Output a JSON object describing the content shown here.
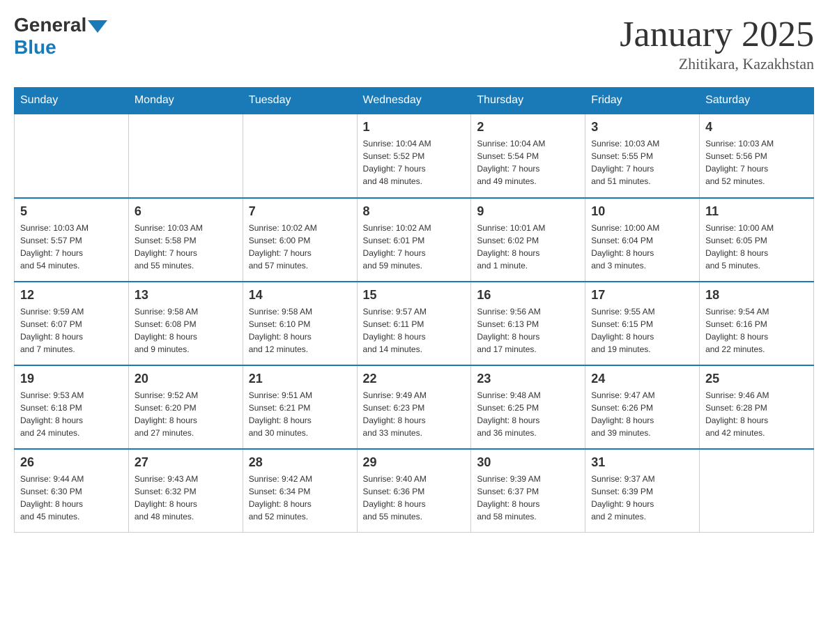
{
  "header": {
    "logo_general": "General",
    "logo_blue": "Blue",
    "month_title": "January 2025",
    "location": "Zhitikara, Kazakhstan"
  },
  "weekdays": [
    "Sunday",
    "Monday",
    "Tuesday",
    "Wednesday",
    "Thursday",
    "Friday",
    "Saturday"
  ],
  "weeks": [
    [
      {
        "day": "",
        "info": ""
      },
      {
        "day": "",
        "info": ""
      },
      {
        "day": "",
        "info": ""
      },
      {
        "day": "1",
        "info": "Sunrise: 10:04 AM\nSunset: 5:52 PM\nDaylight: 7 hours\nand 48 minutes."
      },
      {
        "day": "2",
        "info": "Sunrise: 10:04 AM\nSunset: 5:54 PM\nDaylight: 7 hours\nand 49 minutes."
      },
      {
        "day": "3",
        "info": "Sunrise: 10:03 AM\nSunset: 5:55 PM\nDaylight: 7 hours\nand 51 minutes."
      },
      {
        "day": "4",
        "info": "Sunrise: 10:03 AM\nSunset: 5:56 PM\nDaylight: 7 hours\nand 52 minutes."
      }
    ],
    [
      {
        "day": "5",
        "info": "Sunrise: 10:03 AM\nSunset: 5:57 PM\nDaylight: 7 hours\nand 54 minutes."
      },
      {
        "day": "6",
        "info": "Sunrise: 10:03 AM\nSunset: 5:58 PM\nDaylight: 7 hours\nand 55 minutes."
      },
      {
        "day": "7",
        "info": "Sunrise: 10:02 AM\nSunset: 6:00 PM\nDaylight: 7 hours\nand 57 minutes."
      },
      {
        "day": "8",
        "info": "Sunrise: 10:02 AM\nSunset: 6:01 PM\nDaylight: 7 hours\nand 59 minutes."
      },
      {
        "day": "9",
        "info": "Sunrise: 10:01 AM\nSunset: 6:02 PM\nDaylight: 8 hours\nand 1 minute."
      },
      {
        "day": "10",
        "info": "Sunrise: 10:00 AM\nSunset: 6:04 PM\nDaylight: 8 hours\nand 3 minutes."
      },
      {
        "day": "11",
        "info": "Sunrise: 10:00 AM\nSunset: 6:05 PM\nDaylight: 8 hours\nand 5 minutes."
      }
    ],
    [
      {
        "day": "12",
        "info": "Sunrise: 9:59 AM\nSunset: 6:07 PM\nDaylight: 8 hours\nand 7 minutes."
      },
      {
        "day": "13",
        "info": "Sunrise: 9:58 AM\nSunset: 6:08 PM\nDaylight: 8 hours\nand 9 minutes."
      },
      {
        "day": "14",
        "info": "Sunrise: 9:58 AM\nSunset: 6:10 PM\nDaylight: 8 hours\nand 12 minutes."
      },
      {
        "day": "15",
        "info": "Sunrise: 9:57 AM\nSunset: 6:11 PM\nDaylight: 8 hours\nand 14 minutes."
      },
      {
        "day": "16",
        "info": "Sunrise: 9:56 AM\nSunset: 6:13 PM\nDaylight: 8 hours\nand 17 minutes."
      },
      {
        "day": "17",
        "info": "Sunrise: 9:55 AM\nSunset: 6:15 PM\nDaylight: 8 hours\nand 19 minutes."
      },
      {
        "day": "18",
        "info": "Sunrise: 9:54 AM\nSunset: 6:16 PM\nDaylight: 8 hours\nand 22 minutes."
      }
    ],
    [
      {
        "day": "19",
        "info": "Sunrise: 9:53 AM\nSunset: 6:18 PM\nDaylight: 8 hours\nand 24 minutes."
      },
      {
        "day": "20",
        "info": "Sunrise: 9:52 AM\nSunset: 6:20 PM\nDaylight: 8 hours\nand 27 minutes."
      },
      {
        "day": "21",
        "info": "Sunrise: 9:51 AM\nSunset: 6:21 PM\nDaylight: 8 hours\nand 30 minutes."
      },
      {
        "day": "22",
        "info": "Sunrise: 9:49 AM\nSunset: 6:23 PM\nDaylight: 8 hours\nand 33 minutes."
      },
      {
        "day": "23",
        "info": "Sunrise: 9:48 AM\nSunset: 6:25 PM\nDaylight: 8 hours\nand 36 minutes."
      },
      {
        "day": "24",
        "info": "Sunrise: 9:47 AM\nSunset: 6:26 PM\nDaylight: 8 hours\nand 39 minutes."
      },
      {
        "day": "25",
        "info": "Sunrise: 9:46 AM\nSunset: 6:28 PM\nDaylight: 8 hours\nand 42 minutes."
      }
    ],
    [
      {
        "day": "26",
        "info": "Sunrise: 9:44 AM\nSunset: 6:30 PM\nDaylight: 8 hours\nand 45 minutes."
      },
      {
        "day": "27",
        "info": "Sunrise: 9:43 AM\nSunset: 6:32 PM\nDaylight: 8 hours\nand 48 minutes."
      },
      {
        "day": "28",
        "info": "Sunrise: 9:42 AM\nSunset: 6:34 PM\nDaylight: 8 hours\nand 52 minutes."
      },
      {
        "day": "29",
        "info": "Sunrise: 9:40 AM\nSunset: 6:36 PM\nDaylight: 8 hours\nand 55 minutes."
      },
      {
        "day": "30",
        "info": "Sunrise: 9:39 AM\nSunset: 6:37 PM\nDaylight: 8 hours\nand 58 minutes."
      },
      {
        "day": "31",
        "info": "Sunrise: 9:37 AM\nSunset: 6:39 PM\nDaylight: 9 hours\nand 2 minutes."
      },
      {
        "day": "",
        "info": ""
      }
    ]
  ]
}
